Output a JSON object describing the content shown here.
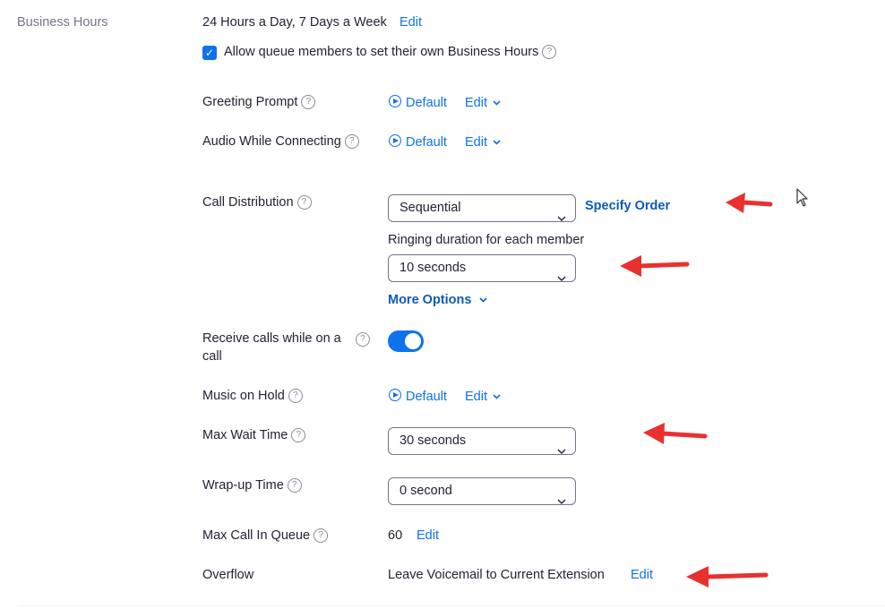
{
  "business_hours": {
    "label": "Business Hours",
    "value": "24 Hours a Day, 7 Days a Week",
    "edit": "Edit",
    "allow_own_hours": "Allow queue members to set their own Business Hours",
    "allow_checked": true
  },
  "greeting_prompt": {
    "label": "Greeting Prompt",
    "value": "Default",
    "edit": "Edit"
  },
  "audio_connecting": {
    "label": "Audio While Connecting",
    "value": "Default",
    "edit": "Edit"
  },
  "call_distribution": {
    "label": "Call Distribution",
    "value": "Sequential",
    "specify_order": "Specify Order",
    "ringing_label": "Ringing duration for each member",
    "ringing_value": "10 seconds",
    "more_options": "More Options"
  },
  "receive_calls": {
    "label_line1": "Receive calls while on a",
    "label_line2": "call",
    "enabled": true
  },
  "music_on_hold": {
    "label": "Music on Hold",
    "value": "Default",
    "edit": "Edit"
  },
  "max_wait": {
    "label": "Max Wait Time",
    "value": "30 seconds"
  },
  "wrapup": {
    "label": "Wrap-up Time",
    "value": "0 second"
  },
  "max_call_queue": {
    "label": "Max Call In Queue",
    "value": "60",
    "edit": "Edit"
  },
  "overflow": {
    "label": "Overflow",
    "value": "Leave Voicemail to Current Extension",
    "edit": "Edit"
  },
  "icons": {
    "help": "help-circle-icon",
    "play": "play-circle-icon",
    "chevron": "chevron-down-icon",
    "check": "checkmark-icon",
    "annotation": "red-arrow-icon",
    "cursor": "mouse-cursor-icon"
  },
  "colors": {
    "accent": "#0e72ed",
    "annotation": "#e8312f"
  }
}
